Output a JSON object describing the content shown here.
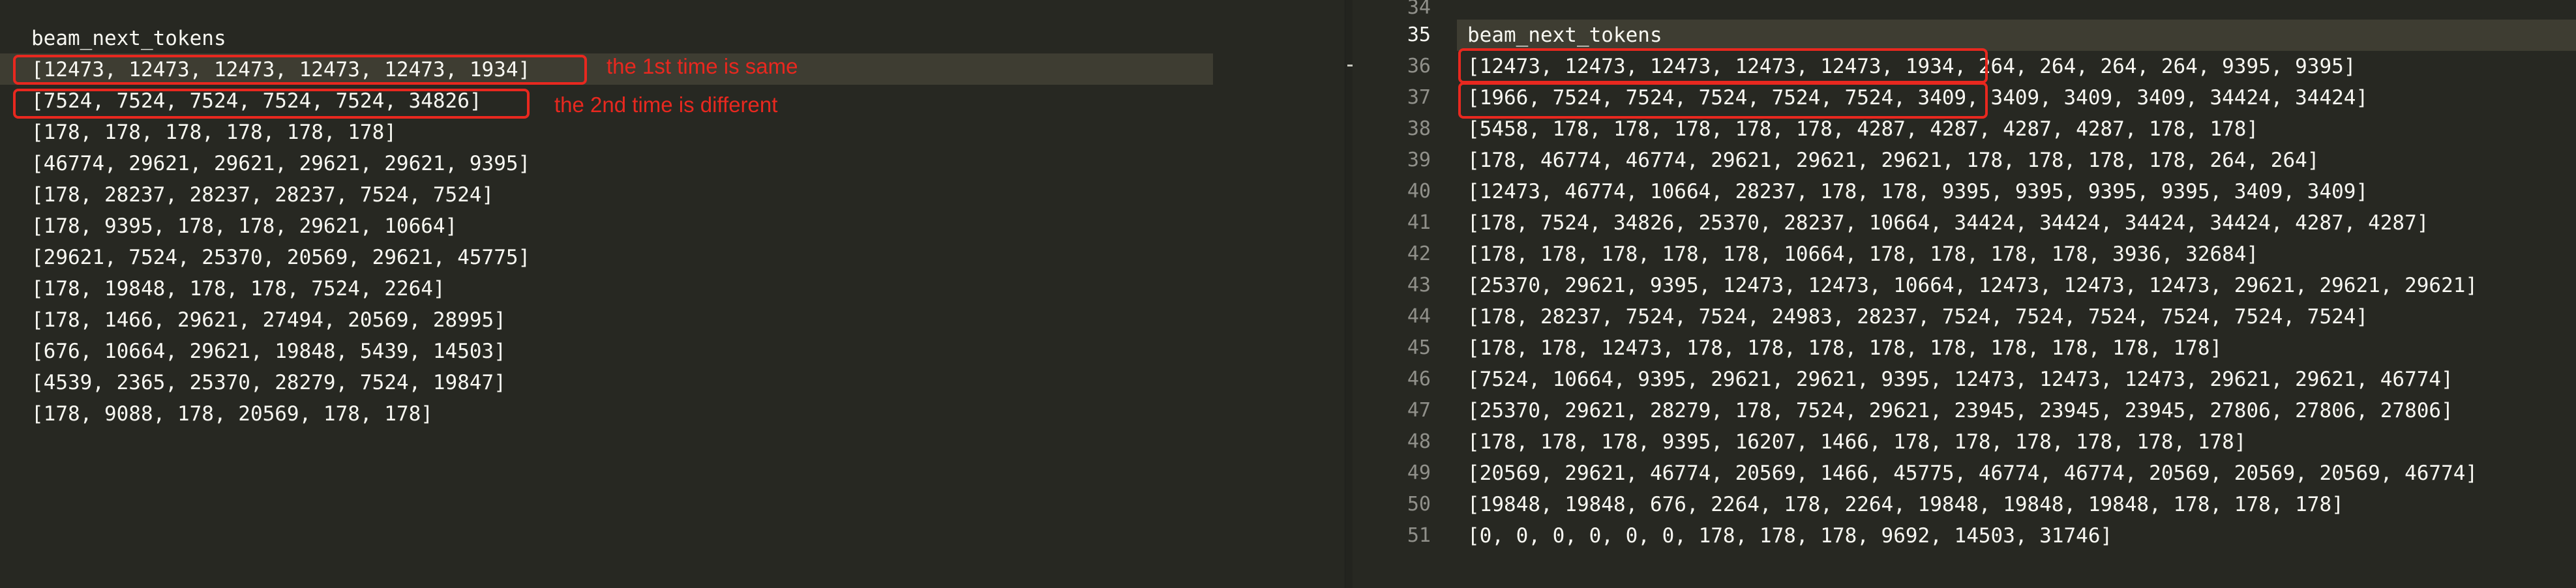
{
  "left_pane": {
    "lines": [
      "beam_next_tokens",
      "[12473, 12473, 12473, 12473, 12473, 1934]",
      "[7524, 7524, 7524, 7524, 7524, 34826]",
      "[178, 178, 178, 178, 178, 178]",
      "[46774, 29621, 29621, 29621, 29621, 9395]",
      "[178, 28237, 28237, 28237, 7524, 7524]",
      "[178, 9395, 178, 178, 29621, 10664]",
      "[29621, 7524, 25370, 20569, 29621, 45775]",
      "[178, 19848, 178, 178, 7524, 2264]",
      "[178, 1466, 29621, 27494, 20569, 28995]",
      "[676, 10664, 29621, 19848, 5439, 14503]",
      "[4539, 2365, 25370, 28279, 7524, 19847]",
      "[178, 9088, 178, 20569, 178, 178]"
    ]
  },
  "right_pane": {
    "line_numbers": [
      "34",
      "35",
      "36",
      "37",
      "38",
      "39",
      "40",
      "41",
      "42",
      "43",
      "44",
      "45",
      "46",
      "47",
      "48",
      "49",
      "50",
      "51"
    ],
    "lines": [
      "",
      "beam_next_tokens",
      "[12473, 12473, 12473, 12473, 12473, 1934, 264, 264, 264, 264, 9395, 9395]",
      "[1966, 7524, 7524, 7524, 7524, 7524, 3409, 3409, 3409, 3409, 34424, 34424]",
      "[5458, 178, 178, 178, 178, 178, 4287, 4287, 4287, 4287, 178, 178]",
      "[178, 46774, 46774, 29621, 29621, 29621, 178, 178, 178, 178, 264, 264]",
      "[12473, 46774, 10664, 28237, 178, 178, 9395, 9395, 9395, 9395, 3409, 3409]",
      "[178, 7524, 34826, 25370, 28237, 10664, 34424, 34424, 34424, 34424, 4287, 4287]",
      "[178, 178, 178, 178, 178, 10664, 178, 178, 178, 178, 3936, 32684]",
      "[25370, 29621, 9395, 12473, 12473, 10664, 12473, 12473, 12473, 29621, 29621, 29621]",
      "[178, 28237, 7524, 7524, 24983, 28237, 7524, 7524, 7524, 7524, 7524, 7524]",
      "[178, 178, 12473, 178, 178, 178, 178, 178, 178, 178, 178, 178]",
      "[7524, 10664, 9395, 29621, 29621, 9395, 12473, 12473, 12473, 29621, 29621, 46774]",
      "[25370, 29621, 28279, 178, 7524, 29621, 23945, 23945, 23945, 27806, 27806, 27806]",
      "[178, 178, 178, 9395, 16207, 1466, 178, 178, 178, 178, 178, 178]",
      "[20569, 29621, 46774, 20569, 1466, 45775, 46774, 46774, 20569, 20569, 20569, 46774]",
      "[19848, 19848, 676, 2264, 178, 2264, 19848, 19848, 19848, 178, 178, 178]",
      "[0, 0, 0, 0, 0, 0, 178, 178, 178, 9692, 14503, 31746]"
    ]
  },
  "annotations": {
    "first_note": "the 1st time is same",
    "second_note": "the 2nd time is different"
  },
  "colors": {
    "background": "#272822",
    "current_line": "#3e3d32",
    "text": "#f8f8f2",
    "line_number": "#90908a",
    "annotation_red": "#e8281f"
  }
}
